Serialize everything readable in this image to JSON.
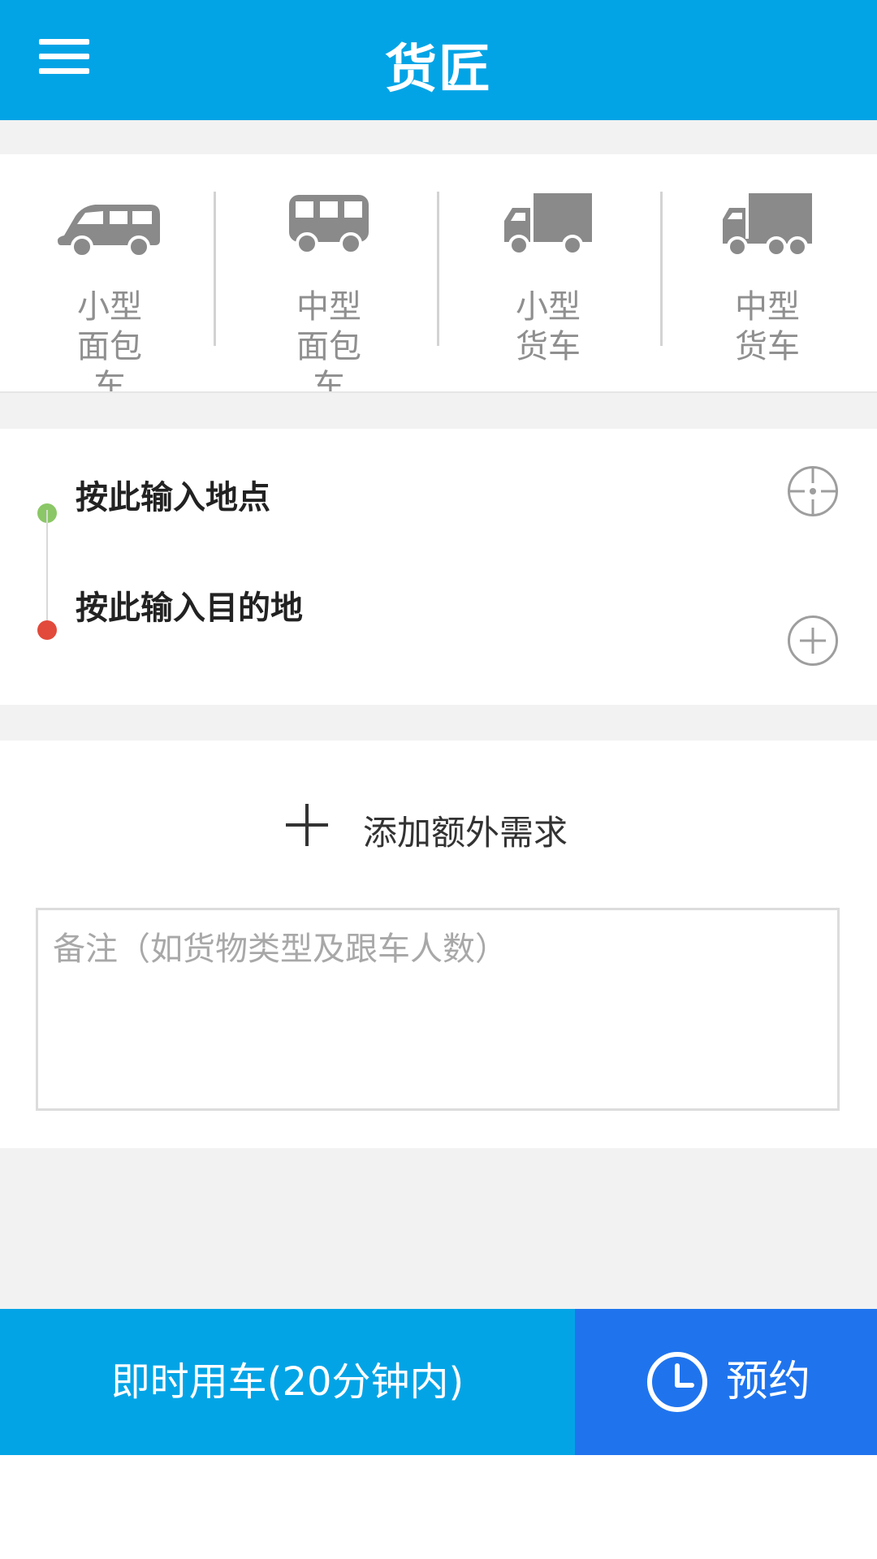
{
  "header": {
    "title": "货匠"
  },
  "vehicles": [
    {
      "label": "小型面包车",
      "icon": "van-icon"
    },
    {
      "label": "中型面包车",
      "icon": "minibus-icon"
    },
    {
      "label": "小型货车",
      "icon": "small-truck-icon"
    },
    {
      "label": "中型货车",
      "icon": "medium-truck-icon"
    }
  ],
  "addresses": {
    "origin_placeholder": "按此输入地点",
    "destination_placeholder": "按此输入目的地",
    "origin_color": "#8bc766",
    "destination_color": "#e24a3b"
  },
  "extras": {
    "add_label": "添加额外需求",
    "notes_placeholder": "备注（如货物类型及跟车人数）"
  },
  "actions": {
    "now_label": "即时用车(20分钟内)",
    "reserve_label": "预约"
  },
  "colors": {
    "primary": "#03a4e6",
    "reserve": "#1f74ee",
    "background": "#f2f2f2"
  }
}
